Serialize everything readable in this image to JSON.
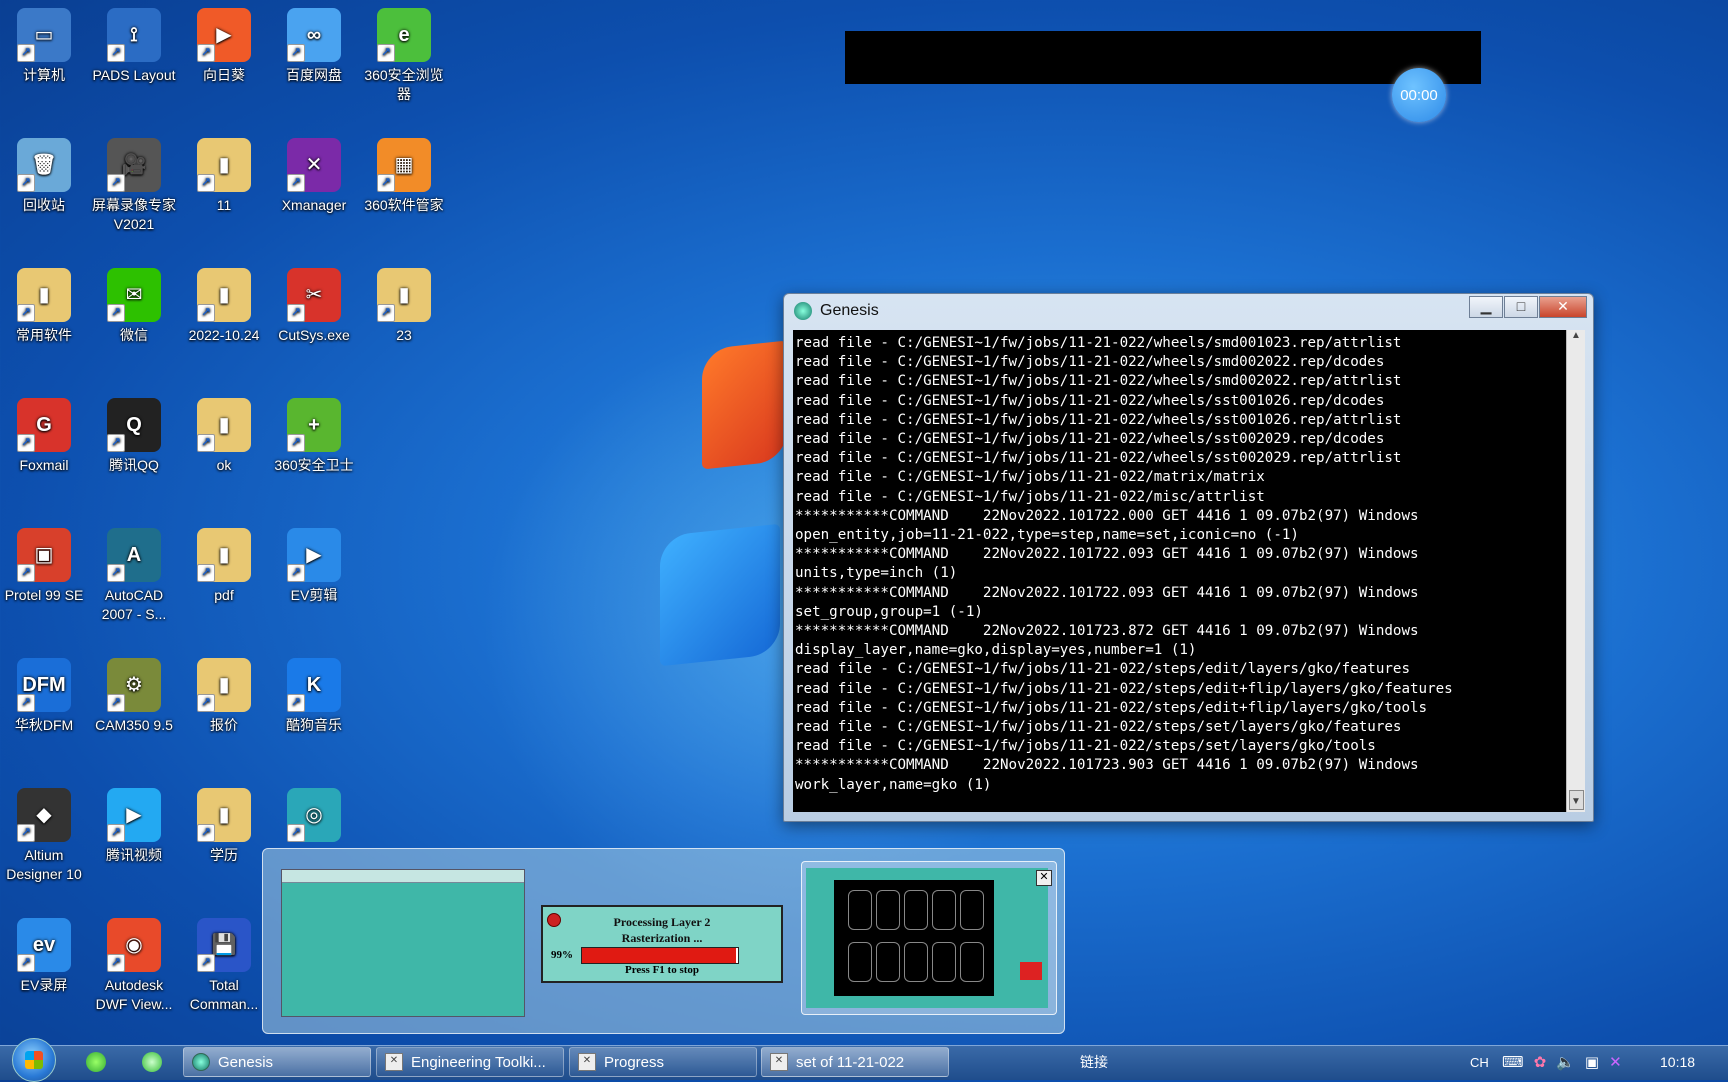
{
  "desktop": {
    "icons": [
      {
        "label": "计算机",
        "color": "#3b79c8",
        "glyph": "▭"
      },
      {
        "label": "PADS Layout",
        "color": "#2b6cc4",
        "glyph": "⟟"
      },
      {
        "label": "向日葵",
        "color": "#f05a28",
        "glyph": "▶"
      },
      {
        "label": "百度网盘",
        "color": "#4aa3f0",
        "glyph": "∞"
      },
      {
        "label": "360安全浏览器",
        "color": "#4cbf3c",
        "glyph": "e"
      },
      {
        "label": "回收站",
        "color": "#6aa9d8",
        "glyph": "🗑"
      },
      {
        "label": "屏幕录像专家V2021",
        "color": "#555",
        "glyph": "🎥"
      },
      {
        "label": "11",
        "color": "#e8c873",
        "glyph": "▮"
      },
      {
        "label": "Xmanager",
        "color": "#7b2aa8",
        "glyph": "✕"
      },
      {
        "label": "360软件管家",
        "color": "#f28c28",
        "glyph": "▦"
      },
      {
        "label": "常用软件",
        "color": "#e8c873",
        "glyph": "▮"
      },
      {
        "label": "微信",
        "color": "#2dc100",
        "glyph": "✉"
      },
      {
        "label": "2022-10.24",
        "color": "#e8c873",
        "glyph": "▮"
      },
      {
        "label": "CutSys.exe",
        "color": "#d8332b",
        "glyph": "✂"
      },
      {
        "label": "23",
        "color": "#e8c873",
        "glyph": "▮"
      },
      {
        "label": "Foxmail",
        "color": "#d8332b",
        "glyph": "G"
      },
      {
        "label": "腾讯QQ",
        "color": "#222",
        "glyph": "Q"
      },
      {
        "label": "ok",
        "color": "#e8c873",
        "glyph": "▮"
      },
      {
        "label": "360安全卫士",
        "color": "#59b62f",
        "glyph": "+"
      },
      {
        "label": "Protel 99 SE",
        "color": "#d8402b",
        "glyph": "▣"
      },
      {
        "label": "AutoCAD 2007 - S...",
        "color": "#1f6e8c",
        "glyph": "A"
      },
      {
        "label": "pdf",
        "color": "#e8c873",
        "glyph": "▮"
      },
      {
        "label": "EV剪辑",
        "color": "#2a8ae8",
        "glyph": "▶"
      },
      {
        "label": "华秋DFM",
        "color": "#1a6ed8",
        "glyph": "DFM"
      },
      {
        "label": "CAM350 9.5",
        "color": "#7a8a3a",
        "glyph": "⚙"
      },
      {
        "label": "报价",
        "color": "#e8c873",
        "glyph": "▮"
      },
      {
        "label": "酷狗音乐",
        "color": "#1a7ae8",
        "glyph": "K"
      },
      {
        "label": "Altium Designer 10",
        "color": "#333",
        "glyph": "◆"
      },
      {
        "label": "腾讯视频",
        "color": "#23a9f2",
        "glyph": "▶"
      },
      {
        "label": "学历",
        "color": "#e8c873",
        "glyph": "▮"
      },
      {
        "label": "",
        "color": "#2aa7b8",
        "glyph": "◎"
      },
      {
        "label": "EV录屏",
        "color": "#2a8ae8",
        "glyph": "ev"
      },
      {
        "label": "Autodesk DWF View...",
        "color": "#e84a2a",
        "glyph": "◉"
      },
      {
        "label": "Total Comman...",
        "color": "#2a55c8",
        "glyph": "💾"
      }
    ]
  },
  "timer": "00:00",
  "genesis_window": {
    "title": "Genesis",
    "minimize": "▁",
    "maximize": "□",
    "close": "✕",
    "console_lines": [
      "read file - C:/GENESI~1/fw/jobs/11-21-022/wheels/smd001023.rep/attrlist",
      "read file - C:/GENESI~1/fw/jobs/11-21-022/wheels/smd002022.rep/dcodes",
      "read file - C:/GENESI~1/fw/jobs/11-21-022/wheels/smd002022.rep/attrlist",
      "read file - C:/GENESI~1/fw/jobs/11-21-022/wheels/sst001026.rep/dcodes",
      "read file - C:/GENESI~1/fw/jobs/11-21-022/wheels/sst001026.rep/attrlist",
      "read file - C:/GENESI~1/fw/jobs/11-21-022/wheels/sst002029.rep/dcodes",
      "read file - C:/GENESI~1/fw/jobs/11-21-022/wheels/sst002029.rep/attrlist",
      "read file - C:/GENESI~1/fw/jobs/11-21-022/matrix/matrix",
      "read file - C:/GENESI~1/fw/jobs/11-21-022/misc/attrlist",
      "***********COMMAND    22Nov2022.101722.000 GET 4416 1 09.07b2(97) Windows",
      "open_entity,job=11-21-022,type=step,name=set,iconic=no (-1)",
      "***********COMMAND    22Nov2022.101722.093 GET 4416 1 09.07b2(97) Windows",
      "units,type=inch (1)",
      "***********COMMAND    22Nov2022.101722.093 GET 4416 1 09.07b2(97) Windows",
      "set_group,group=1 (-1)",
      "***********COMMAND    22Nov2022.101723.872 GET 4416 1 09.07b2(97) Windows",
      "display_layer,name=gko,display=yes,number=1 (1)",
      "read file - C:/GENESI~1/fw/jobs/11-21-022/steps/edit/layers/gko/features",
      "read file - C:/GENESI~1/fw/jobs/11-21-022/steps/edit+flip/layers/gko/features",
      "read file - C:/GENESI~1/fw/jobs/11-21-022/steps/edit+flip/layers/gko/tools",
      "read file - C:/GENESI~1/fw/jobs/11-21-022/steps/set/layers/gko/features",
      "read file - C:/GENESI~1/fw/jobs/11-21-022/steps/set/layers/gko/tools",
      "***********COMMAND    22Nov2022.101723.903 GET 4416 1 09.07b2(97) Windows",
      "work_layer,name=gko (1)"
    ]
  },
  "progress_preview": {
    "line1": "Processing Layer 2",
    "line2": "Rasterization ...",
    "percent_label": "99%",
    "percent": 0.99,
    "footer": "Press F1 to stop"
  },
  "taskbar": {
    "buttons": [
      {
        "label": "Genesis",
        "icon": "genesis-icon"
      },
      {
        "label": "Engineering Toolki...",
        "icon": "window-icon"
      },
      {
        "label": "Progress",
        "icon": "window-icon"
      },
      {
        "label": "set of 11-21-022",
        "icon": "window-icon"
      }
    ],
    "link_label": "链接",
    "lang": "CH",
    "clock": "10:18"
  }
}
